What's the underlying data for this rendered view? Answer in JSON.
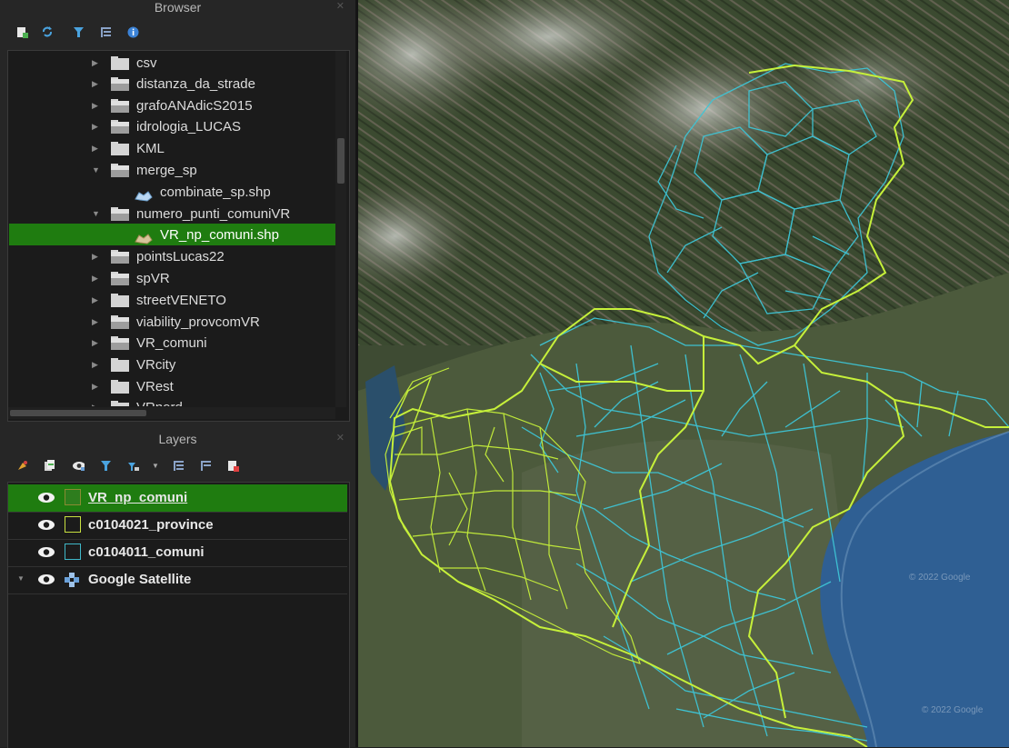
{
  "browser": {
    "title": "Browser",
    "items": [
      {
        "label": "csv",
        "type": "folder",
        "expanded": false
      },
      {
        "label": "distanza_da_strade",
        "type": "folder-open",
        "expanded": false
      },
      {
        "label": "grafoANAdicS2015",
        "type": "folder-open",
        "expanded": false
      },
      {
        "label": "idrologia_LUCAS",
        "type": "folder-open",
        "expanded": false
      },
      {
        "label": "KML",
        "type": "folder",
        "expanded": false
      },
      {
        "label": "merge_sp",
        "type": "folder-open",
        "expanded": true
      },
      {
        "label": "combinate_sp.shp",
        "type": "shapefile"
      },
      {
        "label": "numero_punti_comuniVR",
        "type": "folder-open",
        "expanded": true
      },
      {
        "label": "VR_np_comuni.shp",
        "type": "shapefile",
        "selected": true
      },
      {
        "label": "pointsLucas22",
        "type": "folder-open",
        "expanded": false
      },
      {
        "label": "spVR",
        "type": "folder-open",
        "expanded": false
      },
      {
        "label": "streetVENETO",
        "type": "folder",
        "expanded": false
      },
      {
        "label": "viability_provcomVR",
        "type": "folder-open",
        "expanded": false
      },
      {
        "label": "VR_comuni",
        "type": "folder-open",
        "expanded": false
      },
      {
        "label": "VRcity",
        "type": "folder",
        "expanded": false
      },
      {
        "label": "VRest",
        "type": "folder",
        "expanded": false
      },
      {
        "label": "VRnord",
        "type": "folder",
        "expanded": false
      }
    ],
    "toolbar_icons": [
      "add-layer-icon",
      "refresh-icon",
      "filter-icon",
      "collapse-all-icon",
      "info-icon"
    ]
  },
  "layers": {
    "title": "Layers",
    "toolbar_icons": [
      "style-icon",
      "add-group-icon",
      "manage-visibility-icon",
      "filter-legend-icon",
      "filter-expression-icon",
      "dropdown-icon",
      "expand-all-icon",
      "collapse-all-icon",
      "remove-layer-icon"
    ],
    "items": [
      {
        "label": "VR_np_comuni",
        "selected": true,
        "visible": true,
        "swatch": "#2e7d1e",
        "swatch_border": "#8a8a33"
      },
      {
        "label": "c0104021_province",
        "selected": false,
        "visible": true,
        "swatch": "#1b1b1b",
        "swatch_border": "#c8e040"
      },
      {
        "label": "c0104011_comuni",
        "selected": false,
        "visible": true,
        "swatch": "#1b1b1b",
        "swatch_border": "#3fb8c8"
      },
      {
        "label": "Google Satellite",
        "selected": false,
        "visible": true,
        "group": true
      }
    ]
  },
  "map": {
    "watermark1": "© 2022 Google",
    "watermark2": "© 2022 Google",
    "province_color": "#c6f03a",
    "comuni_color": "#3ec5d6"
  }
}
